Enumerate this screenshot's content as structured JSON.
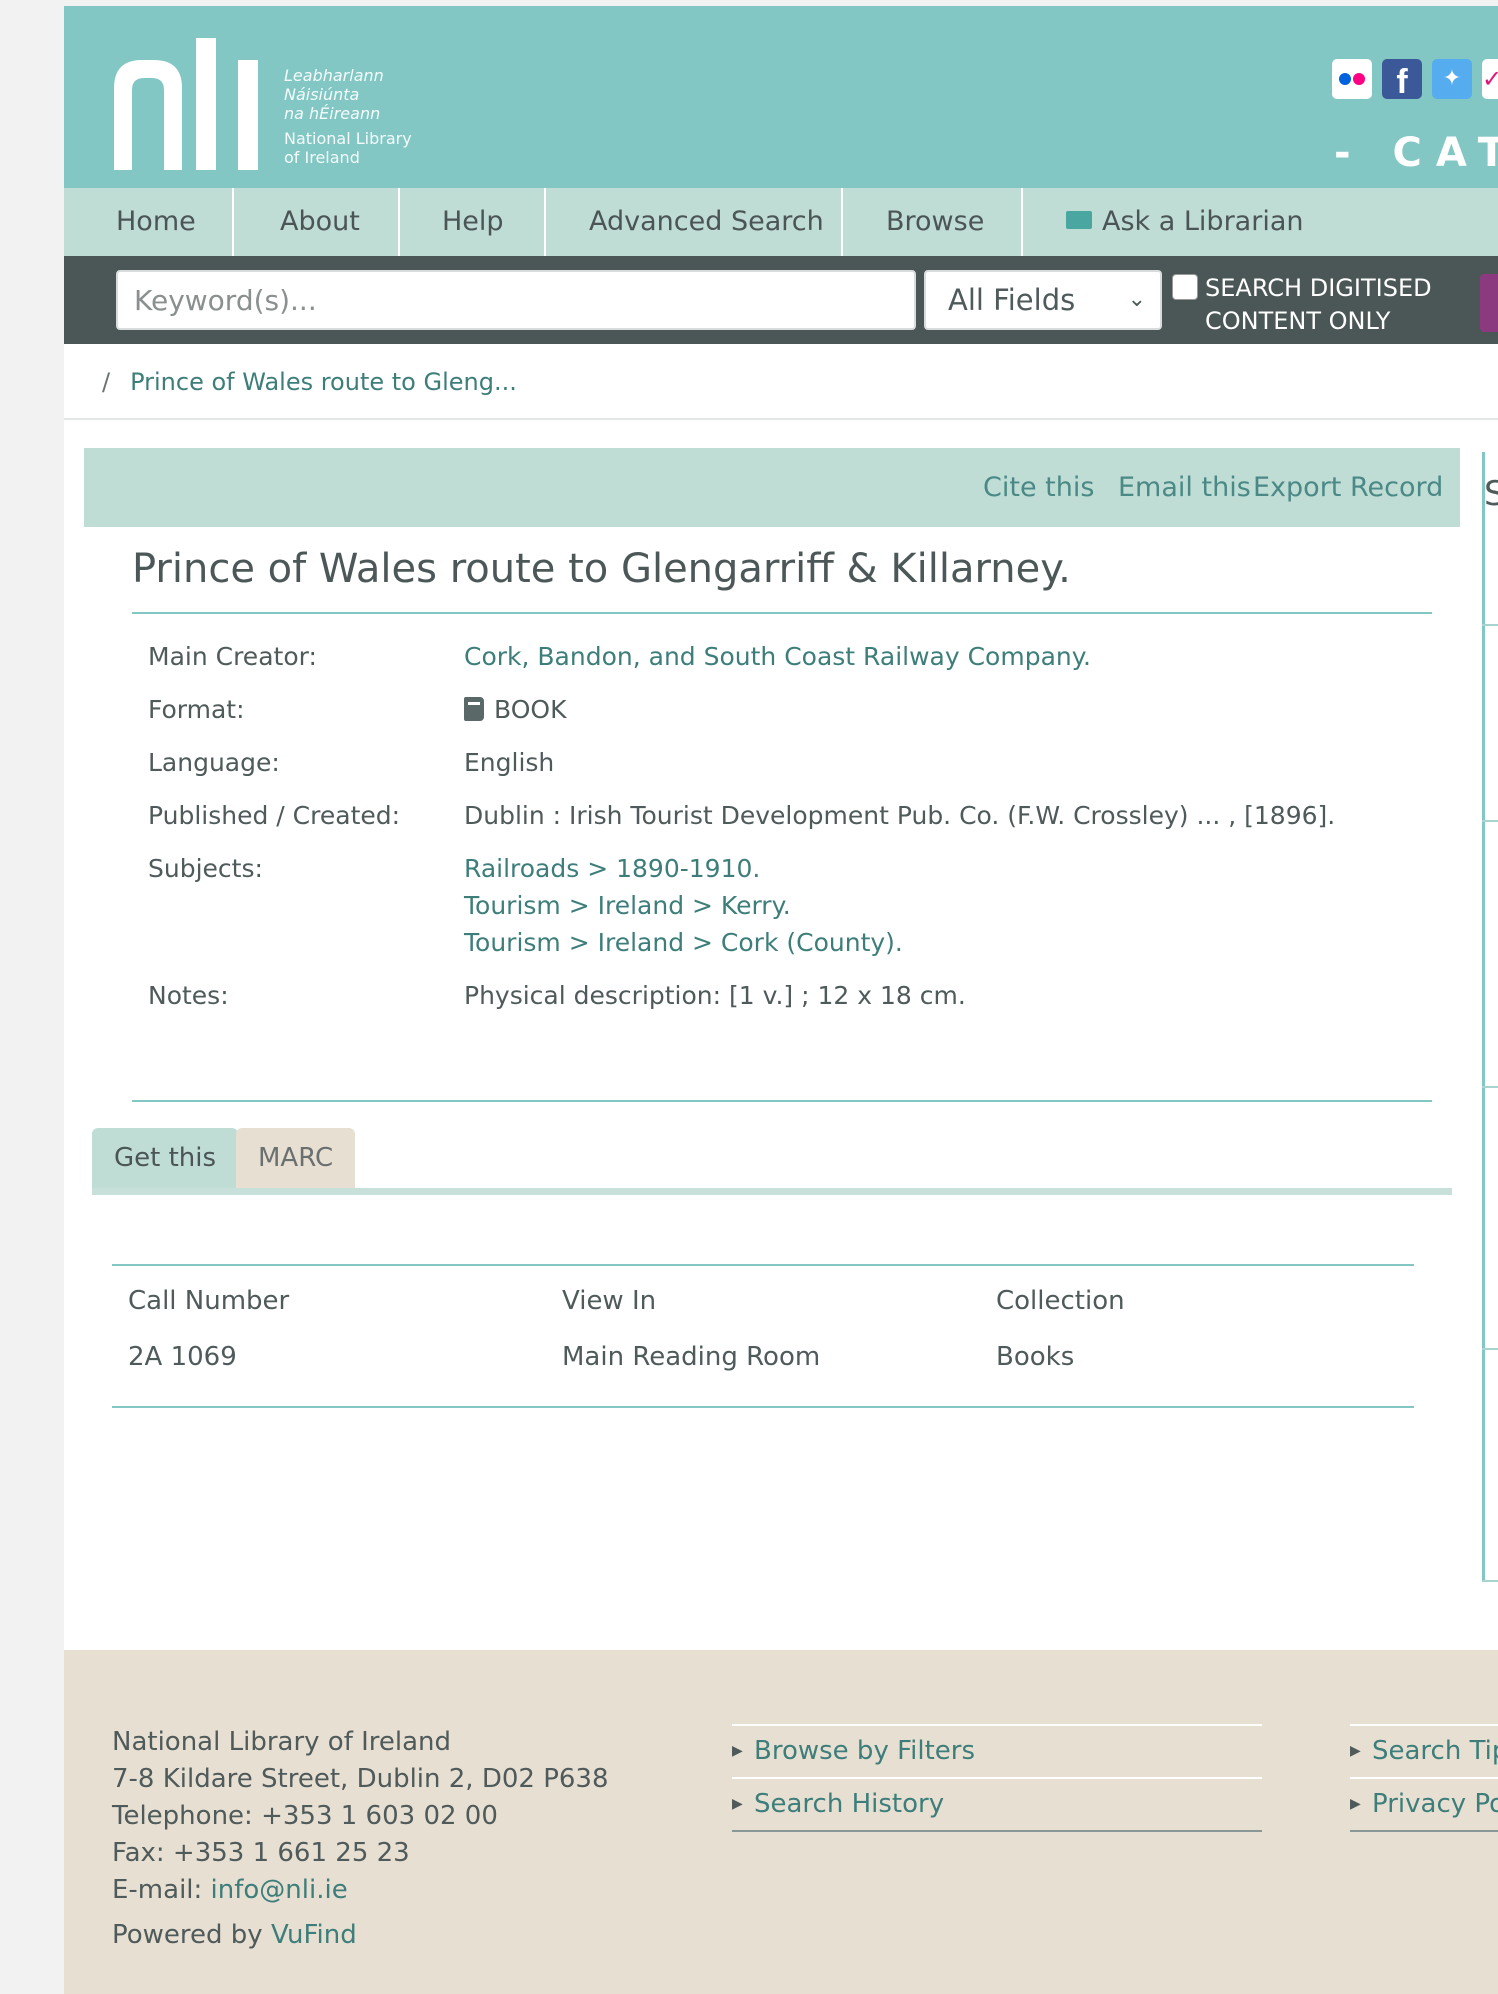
{
  "header": {
    "logo_letters": "nli",
    "logo_irish": [
      "Leabharlann",
      "Náisiúnta",
      "na hÉireann"
    ],
    "logo_english": [
      "National Library",
      "of Ireland"
    ],
    "catalogue_text": "- CAT",
    "social": [
      "flickr-icon",
      "facebook-icon",
      "twitter-icon",
      "instagram-icon"
    ]
  },
  "nav": {
    "items": [
      "Home",
      "About",
      "Help",
      "Advanced Search",
      "Browse",
      "Ask a Librarian"
    ]
  },
  "search": {
    "placeholder": "Keyword(s)...",
    "field_selected": "All Fields",
    "digitised_label": "SEARCH DIGITISED CONTENT ONLY"
  },
  "breadcrumb": {
    "separator": "/",
    "current": "Prince of Wales route to Gleng..."
  },
  "toolbar": {
    "cite": "Cite this",
    "email": "Email this",
    "export": "Export Record"
  },
  "record": {
    "title": "Prince of Wales route to Glengarriff & Killarney.",
    "main_creator_label": "Main Creator:",
    "main_creator": "Cork, Bandon, and South Coast Railway Company.",
    "format_label": "Format:",
    "format": "BOOK",
    "language_label": "Language:",
    "language": "English",
    "published_label": "Published / Created:",
    "published": "Dublin : Irish Tourist Development Pub. Co. (F.W. Crossley) ... , [1896].",
    "subjects_label": "Subjects:",
    "subjects": [
      [
        "Railroads",
        "1890-1910."
      ],
      [
        "Tourism",
        "Ireland",
        "Kerry."
      ],
      [
        "Tourism",
        "Ireland",
        "Cork (County)."
      ]
    ],
    "notes_label": "Notes:",
    "notes": "Physical description: [1 v.] ; 12 x 18 cm."
  },
  "tabs": {
    "get_this": "Get this",
    "marc": "MARC"
  },
  "holdings": {
    "headers": [
      "Call Number",
      "View In",
      "Collection"
    ],
    "rows": [
      [
        "2A 1069",
        "Main Reading Room",
        "Books"
      ]
    ]
  },
  "sidebar": {
    "heading_letter": "S"
  },
  "footer": {
    "org": "National Library of Ireland",
    "street": "7-8 Kildare Street, Dublin 2, D02 P638",
    "telephone": "Telephone: +353 1 603 02 00",
    "fax": "Fax: +353 1 661 25 23",
    "email_label": "E-mail:",
    "email": "info@nli.ie",
    "powered_label": "Powered by",
    "powered_link": "VuFind",
    "links_col1": [
      "Browse by Filters",
      "Search History"
    ],
    "links_col2": [
      "Search Tips",
      "Privacy Policy"
    ]
  },
  "colors": {
    "header_teal": "#82c7c4",
    "nav_mint": "#bfdcd5",
    "search_bar": "#4a5756",
    "link_teal": "#3d7e7a",
    "footer_beige": "#e8dfd3",
    "accent_purple": "#8b3a80"
  }
}
